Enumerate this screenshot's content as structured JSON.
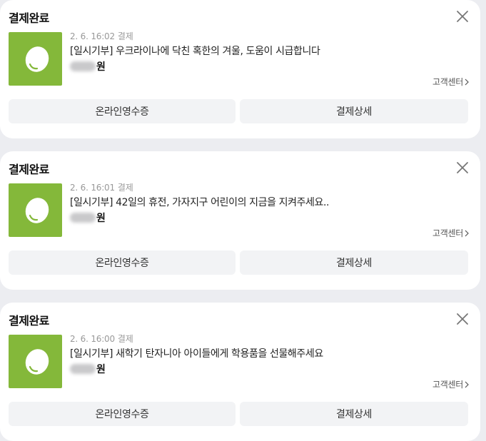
{
  "cards": [
    {
      "title": "결제완료",
      "date": "2. 6. 16:02",
      "status": "결제",
      "product": "[일시기부] 우크라이나에 닥친 혹한의 겨울, 도움이 시급합니다",
      "currency": "원",
      "cs_label": "고객센터",
      "receipt_label": "온라인영수증",
      "detail_label": "결제상세"
    },
    {
      "title": "결제완료",
      "date": "2. 6. 16:01",
      "status": "결제",
      "product": "[일시기부] 42일의 휴전, 가자지구 어린이의 지금을 지켜주세요..",
      "currency": "원",
      "cs_label": "고객센터",
      "receipt_label": "온라인영수증",
      "detail_label": "결제상세"
    },
    {
      "title": "결제완료",
      "date": "2. 6. 16:00",
      "status": "결제",
      "product": "[일시기부] 새학기 탄자니아 아이들에게 학용품을 선물해주세요",
      "currency": "원",
      "cs_label": "고객센터",
      "receipt_label": "온라인영수증",
      "detail_label": "결제상세"
    }
  ],
  "icons": {
    "close": "close-icon",
    "chevron": "chevron-right-icon",
    "thumbnail": "bean-logo-icon"
  },
  "colors": {
    "thumbnail_bg": "#84b83a",
    "page_bg": "#ecedf1",
    "button_bg": "#f2f3f5"
  }
}
